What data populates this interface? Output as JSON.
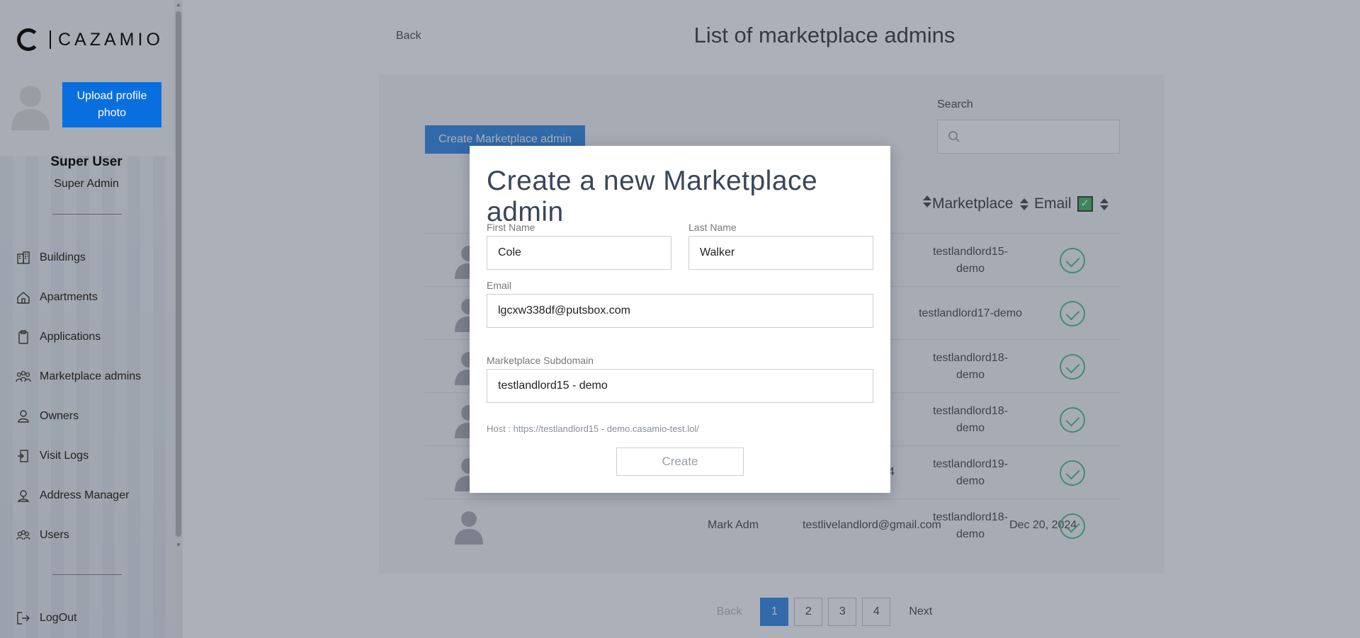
{
  "sidebar": {
    "logo_text": "CAZAMIO",
    "upload_label": "Upload profile photo",
    "user_name": "Super User",
    "user_role": "Super Admin",
    "nav": [
      {
        "label": "Buildings",
        "icon": "buildings-icon"
      },
      {
        "label": "Apartments",
        "icon": "home-icon"
      },
      {
        "label": "Applications",
        "icon": "clipboard-icon"
      },
      {
        "label": "Marketplace admins",
        "icon": "group-icon"
      },
      {
        "label": "Owners",
        "icon": "owner-icon"
      },
      {
        "label": "Visit Logs",
        "icon": "door-icon"
      },
      {
        "label": "Address Manager",
        "icon": "location-person-icon"
      },
      {
        "label": "Users",
        "icon": "users-icon"
      }
    ],
    "logout_label": "LogOut"
  },
  "header": {
    "back_label": "Back",
    "title": "List of marketplace admins"
  },
  "toolbar": {
    "create_label": "Create Marketplace admin",
    "search_label": "Search",
    "search_value": ""
  },
  "table": {
    "headers": [
      "Marketplace",
      "Email"
    ],
    "rows": [
      {
        "name": "",
        "email": "",
        "date": "",
        "marketplace": "testlandlord15-demo"
      },
      {
        "name": "",
        "email": "",
        "date": "",
        "marketplace": "testlandlord17-demo"
      },
      {
        "name": "",
        "email": "",
        "date": "",
        "marketplace": "testlandlord18-demo"
      },
      {
        "name": "",
        "email": "",
        "date": "",
        "marketplace": "testlandlord18-demo"
      },
      {
        "name": "",
        "email": "",
        "date": "4",
        "marketplace": "testlandlord19-demo"
      },
      {
        "name": "Mark Adm",
        "email": "testlivelandlord@gmail.com",
        "date": "Dec 20, 2024",
        "marketplace": "testlandlord18-demo"
      }
    ]
  },
  "pagination": {
    "back_label": "Back",
    "pages": [
      "1",
      "2",
      "3",
      "4"
    ],
    "current": "1",
    "next_label": "Next"
  },
  "modal": {
    "title": "Create a new Marketplace admin",
    "first_name_label": "First Name",
    "first_name_value": "Cole",
    "last_name_label": "Last Name",
    "last_name_value": "Walker",
    "email_label": "Email",
    "email_value": "lgcxw338df@putsbox.com",
    "subdomain_label": "Marketplace Subdomain",
    "subdomain_value": "testlandlord15 - demo",
    "host_text": "Host : https://testlandlord15 - demo.casamio-test.lol/",
    "create_label": "Create"
  },
  "colors": {
    "accent": "#0a6fde",
    "success": "#2bb56b"
  }
}
